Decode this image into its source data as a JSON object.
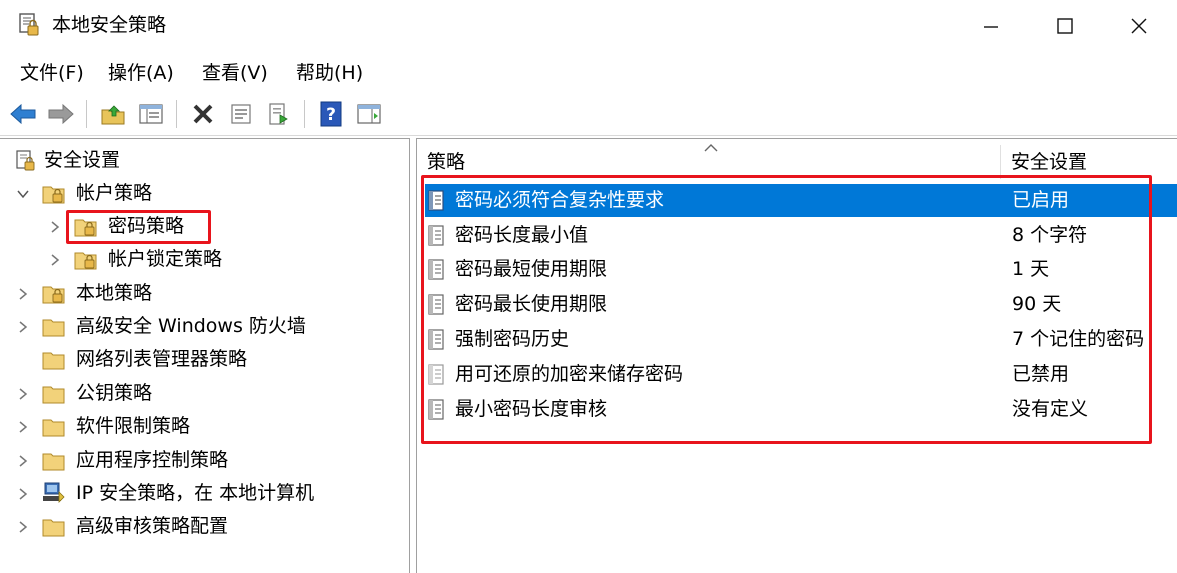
{
  "window": {
    "title": "本地安全策略"
  },
  "menu": [
    {
      "label": "文件(F)"
    },
    {
      "label": "操作(A)"
    },
    {
      "label": "查看(V)"
    },
    {
      "label": "帮助(H)"
    }
  ],
  "tree": [
    {
      "label": "安全设置",
      "level": 0,
      "expanded": true
    },
    {
      "label": "帐户策略",
      "level": 1,
      "expanded": true
    },
    {
      "label": "密码策略",
      "level": 2,
      "expanded": false
    },
    {
      "label": "帐户锁定策略",
      "level": 2,
      "expanded": false
    },
    {
      "label": "本地策略",
      "level": 1,
      "expanded": false
    },
    {
      "label": "高级安全 Windows 防火墙",
      "level": 1,
      "expanded": false
    },
    {
      "label": "网络列表管理器策略",
      "level": 1,
      "expanded": false
    },
    {
      "label": "公钥策略",
      "level": 1,
      "expanded": false
    },
    {
      "label": "软件限制策略",
      "level": 1,
      "expanded": false
    },
    {
      "label": "应用程序控制策略",
      "level": 1,
      "expanded": false
    },
    {
      "label": "IP 安全策略，在 本地计算机",
      "level": 1,
      "expanded": false
    },
    {
      "label": "高级审核策略配置",
      "level": 1,
      "expanded": false
    }
  ],
  "list": {
    "columns": {
      "policy": "策略",
      "setting": "安全设置"
    },
    "rows": [
      {
        "name": "密码必须符合复杂性要求",
        "value": "已启用",
        "selected": true
      },
      {
        "name": "密码长度最小值",
        "value": "8 个字符",
        "selected": false
      },
      {
        "name": "密码最短使用期限",
        "value": "1 天",
        "selected": false
      },
      {
        "name": "密码最长使用期限",
        "value": "90 天",
        "selected": false
      },
      {
        "name": "强制密码历史",
        "value": "7 个记住的密码",
        "selected": false
      },
      {
        "name": "用可还原的加密来储存密码",
        "value": "已禁用",
        "selected": false
      },
      {
        "name": "最小密码长度审核",
        "value": "没有定义",
        "selected": false
      }
    ]
  },
  "colors": {
    "selection": "#0078d7",
    "annotation_red": "#e8141c"
  }
}
